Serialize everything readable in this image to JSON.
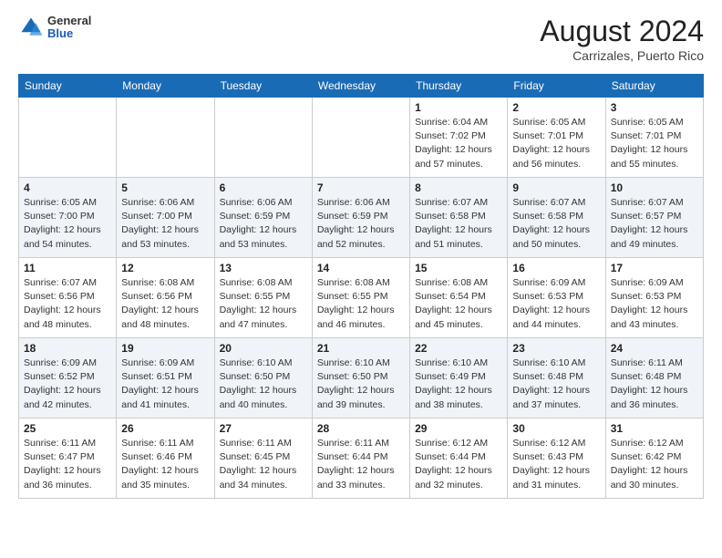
{
  "header": {
    "logo_general": "General",
    "logo_blue": "Blue",
    "month_year": "August 2024",
    "location": "Carrizales, Puerto Rico"
  },
  "days_of_week": [
    "Sunday",
    "Monday",
    "Tuesday",
    "Wednesday",
    "Thursday",
    "Friday",
    "Saturday"
  ],
  "weeks": [
    [
      {
        "day": "",
        "info": ""
      },
      {
        "day": "",
        "info": ""
      },
      {
        "day": "",
        "info": ""
      },
      {
        "day": "",
        "info": ""
      },
      {
        "day": "1",
        "info": "Sunrise: 6:04 AM\nSunset: 7:02 PM\nDaylight: 12 hours\nand 57 minutes."
      },
      {
        "day": "2",
        "info": "Sunrise: 6:05 AM\nSunset: 7:01 PM\nDaylight: 12 hours\nand 56 minutes."
      },
      {
        "day": "3",
        "info": "Sunrise: 6:05 AM\nSunset: 7:01 PM\nDaylight: 12 hours\nand 55 minutes."
      }
    ],
    [
      {
        "day": "4",
        "info": "Sunrise: 6:05 AM\nSunset: 7:00 PM\nDaylight: 12 hours\nand 54 minutes."
      },
      {
        "day": "5",
        "info": "Sunrise: 6:06 AM\nSunset: 7:00 PM\nDaylight: 12 hours\nand 53 minutes."
      },
      {
        "day": "6",
        "info": "Sunrise: 6:06 AM\nSunset: 6:59 PM\nDaylight: 12 hours\nand 53 minutes."
      },
      {
        "day": "7",
        "info": "Sunrise: 6:06 AM\nSunset: 6:59 PM\nDaylight: 12 hours\nand 52 minutes."
      },
      {
        "day": "8",
        "info": "Sunrise: 6:07 AM\nSunset: 6:58 PM\nDaylight: 12 hours\nand 51 minutes."
      },
      {
        "day": "9",
        "info": "Sunrise: 6:07 AM\nSunset: 6:58 PM\nDaylight: 12 hours\nand 50 minutes."
      },
      {
        "day": "10",
        "info": "Sunrise: 6:07 AM\nSunset: 6:57 PM\nDaylight: 12 hours\nand 49 minutes."
      }
    ],
    [
      {
        "day": "11",
        "info": "Sunrise: 6:07 AM\nSunset: 6:56 PM\nDaylight: 12 hours\nand 48 minutes."
      },
      {
        "day": "12",
        "info": "Sunrise: 6:08 AM\nSunset: 6:56 PM\nDaylight: 12 hours\nand 48 minutes."
      },
      {
        "day": "13",
        "info": "Sunrise: 6:08 AM\nSunset: 6:55 PM\nDaylight: 12 hours\nand 47 minutes."
      },
      {
        "day": "14",
        "info": "Sunrise: 6:08 AM\nSunset: 6:55 PM\nDaylight: 12 hours\nand 46 minutes."
      },
      {
        "day": "15",
        "info": "Sunrise: 6:08 AM\nSunset: 6:54 PM\nDaylight: 12 hours\nand 45 minutes."
      },
      {
        "day": "16",
        "info": "Sunrise: 6:09 AM\nSunset: 6:53 PM\nDaylight: 12 hours\nand 44 minutes."
      },
      {
        "day": "17",
        "info": "Sunrise: 6:09 AM\nSunset: 6:53 PM\nDaylight: 12 hours\nand 43 minutes."
      }
    ],
    [
      {
        "day": "18",
        "info": "Sunrise: 6:09 AM\nSunset: 6:52 PM\nDaylight: 12 hours\nand 42 minutes."
      },
      {
        "day": "19",
        "info": "Sunrise: 6:09 AM\nSunset: 6:51 PM\nDaylight: 12 hours\nand 41 minutes."
      },
      {
        "day": "20",
        "info": "Sunrise: 6:10 AM\nSunset: 6:50 PM\nDaylight: 12 hours\nand 40 minutes."
      },
      {
        "day": "21",
        "info": "Sunrise: 6:10 AM\nSunset: 6:50 PM\nDaylight: 12 hours\nand 39 minutes."
      },
      {
        "day": "22",
        "info": "Sunrise: 6:10 AM\nSunset: 6:49 PM\nDaylight: 12 hours\nand 38 minutes."
      },
      {
        "day": "23",
        "info": "Sunrise: 6:10 AM\nSunset: 6:48 PM\nDaylight: 12 hours\nand 37 minutes."
      },
      {
        "day": "24",
        "info": "Sunrise: 6:11 AM\nSunset: 6:48 PM\nDaylight: 12 hours\nand 36 minutes."
      }
    ],
    [
      {
        "day": "25",
        "info": "Sunrise: 6:11 AM\nSunset: 6:47 PM\nDaylight: 12 hours\nand 36 minutes."
      },
      {
        "day": "26",
        "info": "Sunrise: 6:11 AM\nSunset: 6:46 PM\nDaylight: 12 hours\nand 35 minutes."
      },
      {
        "day": "27",
        "info": "Sunrise: 6:11 AM\nSunset: 6:45 PM\nDaylight: 12 hours\nand 34 minutes."
      },
      {
        "day": "28",
        "info": "Sunrise: 6:11 AM\nSunset: 6:44 PM\nDaylight: 12 hours\nand 33 minutes."
      },
      {
        "day": "29",
        "info": "Sunrise: 6:12 AM\nSunset: 6:44 PM\nDaylight: 12 hours\nand 32 minutes."
      },
      {
        "day": "30",
        "info": "Sunrise: 6:12 AM\nSunset: 6:43 PM\nDaylight: 12 hours\nand 31 minutes."
      },
      {
        "day": "31",
        "info": "Sunrise: 6:12 AM\nSunset: 6:42 PM\nDaylight: 12 hours\nand 30 minutes."
      }
    ]
  ]
}
